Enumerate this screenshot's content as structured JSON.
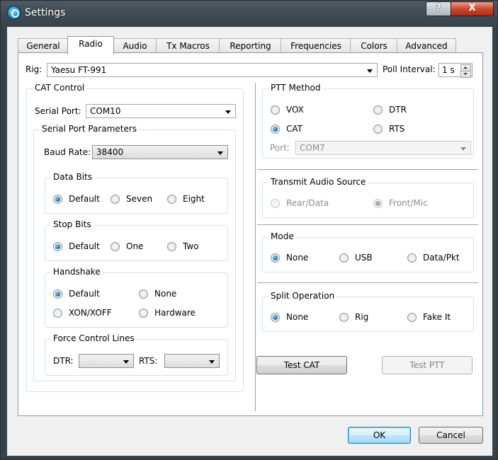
{
  "window": {
    "title": "Settings",
    "help_label": "?",
    "close_label": "X"
  },
  "tabs": [
    {
      "label": "General"
    },
    {
      "label": "Radio"
    },
    {
      "label": "Audio"
    },
    {
      "label": "Tx Macros"
    },
    {
      "label": "Reporting"
    },
    {
      "label": "Frequencies"
    },
    {
      "label": "Colors"
    },
    {
      "label": "Advanced"
    }
  ],
  "rig": {
    "label": "Rig:",
    "value": "Yaesu FT-991",
    "poll_label": "Poll Interval:",
    "poll_value": "1 s"
  },
  "cat": {
    "title": "CAT Control",
    "serial_port_label": "Serial Port:",
    "serial_port_value": "COM10",
    "params": {
      "title": "Serial Port Parameters",
      "baud_label": "Baud Rate:",
      "baud_value": "38400",
      "data_bits": {
        "title": "Data Bits",
        "options": [
          "Default",
          "Seven",
          "Eight"
        ],
        "selected": "Default"
      },
      "stop_bits": {
        "title": "Stop Bits",
        "options": [
          "Default",
          "One",
          "Two"
        ],
        "selected": "Default"
      },
      "handshake": {
        "title": "Handshake",
        "options": [
          "Default",
          "None",
          "XON/XOFF",
          "Hardware"
        ],
        "selected": "Default"
      },
      "force": {
        "title": "Force Control Lines",
        "dtr_label": "DTR:",
        "dtr_value": "",
        "rts_label": "RTS:",
        "rts_value": ""
      }
    }
  },
  "ptt": {
    "title": "PTT Method",
    "options": [
      "VOX",
      "DTR",
      "CAT",
      "RTS"
    ],
    "selected": "CAT",
    "port_label": "Port:",
    "port_value": "COM7"
  },
  "tx_audio": {
    "title": "Transmit Audio Source",
    "options": [
      "Rear/Data",
      "Front/Mic"
    ],
    "selected": "Front/Mic"
  },
  "mode": {
    "title": "Mode",
    "options": [
      "None",
      "USB",
      "Data/Pkt"
    ],
    "selected": "None"
  },
  "split": {
    "title": "Split Operation",
    "options": [
      "None",
      "Rig",
      "Fake It"
    ],
    "selected": "None"
  },
  "buttons": {
    "test_cat": "Test CAT",
    "test_ptt": "Test PTT",
    "ok": "OK",
    "cancel": "Cancel"
  },
  "colors": {
    "accent": "#1a5f9a",
    "titlebar": "#3c464e",
    "close": "#c84a32"
  }
}
